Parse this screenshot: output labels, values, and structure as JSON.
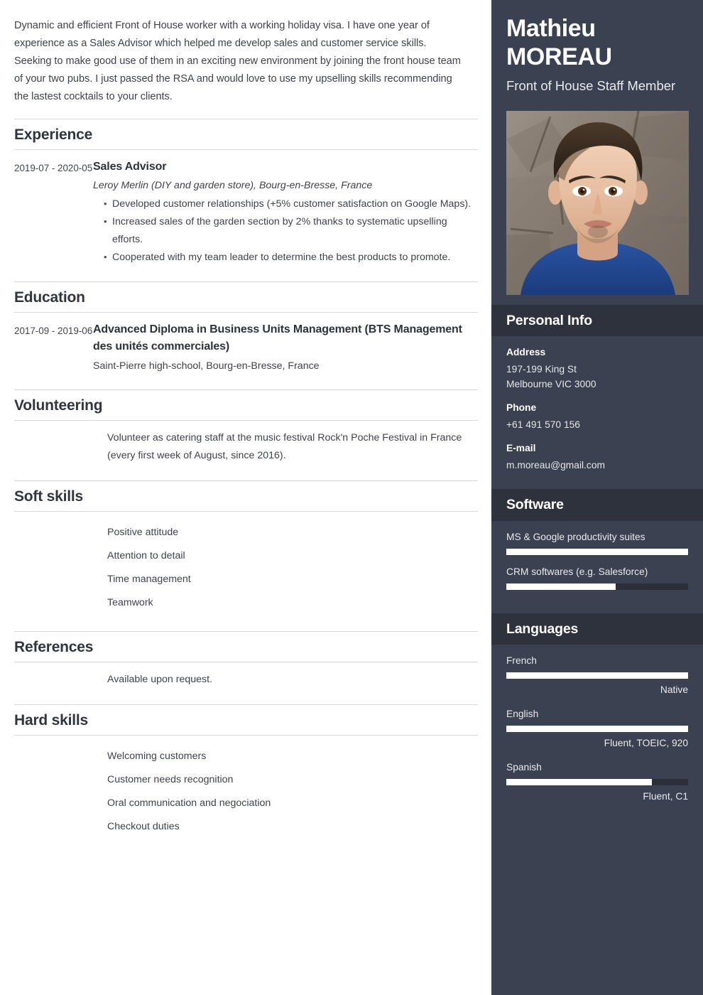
{
  "summary": {
    "text": "Dynamic and efficient Front of House worker with a working holiday visa. I have one year of experience as a Sales Advisor which helped me develop sales and customer service skills. Seeking to make good use of them in an exciting new environment by joining the front house team of your two pubs. I just passed the RSA and would love to use my upselling skills recommending the lastest cocktails to your clients."
  },
  "sections": {
    "experience": {
      "heading": "Experience",
      "entries": [
        {
          "dates": "2019-07 - 2020-05",
          "title": "Sales Advisor",
          "subtitle": "Leroy Merlin (DIY and garden store), Bourg-en-Bresse, France",
          "bullets": [
            "Developed customer relationships (+5% customer satisfaction on Google Maps).",
            "Increased sales of the garden section by 2% thanks to systematic upselling efforts.",
            "Cooperated with my team leader to determine the best products to promote."
          ]
        }
      ]
    },
    "education": {
      "heading": "Education",
      "entries": [
        {
          "dates": "2017-09 - 2019-06",
          "title": "Advanced Diploma in Business Units Management (BTS Management des unités commerciales)",
          "school": "Saint-Pierre high-school, Bourg-en-Bresse, France"
        }
      ]
    },
    "volunteering": {
      "heading": "Volunteering",
      "text": "Volunteer as catering staff at the music festival Rock'n Poche Festival in France (every first week of August, since 2016)."
    },
    "soft_skills": {
      "heading": "Soft skills",
      "items": [
        "Positive attitude",
        "Attention to detail",
        "Time management",
        "Teamwork"
      ]
    },
    "references": {
      "heading": "References",
      "text": "Available upon request."
    },
    "hard_skills": {
      "heading": "Hard skills",
      "items": [
        "Welcoming customers",
        "Customer needs recognition",
        "Oral communication and negociation",
        "Checkout duties"
      ]
    }
  },
  "sidebar": {
    "first_name": "Mathieu",
    "last_name": "MOREAU",
    "job_title": "Front of House Staff Member",
    "photo_alt": "portrait-photo",
    "personal_info": {
      "heading": "Personal Info",
      "groups": [
        {
          "label": "Address",
          "value": "197-199 King St\n Melbourne VIC 3000"
        },
        {
          "label": "Phone",
          "value": "+61 491 570 156"
        },
        {
          "label": "E-mail",
          "value": "m.moreau@gmail.com"
        }
      ]
    },
    "software": {
      "heading": "Software",
      "items": [
        {
          "name": "MS & Google productivity suites",
          "level": 100
        },
        {
          "name": "CRM softwares (e.g. Salesforce)",
          "level": 60
        }
      ]
    },
    "languages": {
      "heading": "Languages",
      "items": [
        {
          "name": "French",
          "level": 100,
          "note": "Native"
        },
        {
          "name": "English",
          "level": 100,
          "note": "Fluent, TOEIC, 920"
        },
        {
          "name": "Spanish",
          "level": 80,
          "note": "Fluent, C1"
        }
      ]
    }
  },
  "theme": {
    "sidebar_bg": "#3a4150",
    "sidebar_header_bg": "#2d323d",
    "bar_fill": "#ffffff",
    "bar_track": "#2a2f3a",
    "rule": "#d7d7d7",
    "text": "#3f434b"
  }
}
